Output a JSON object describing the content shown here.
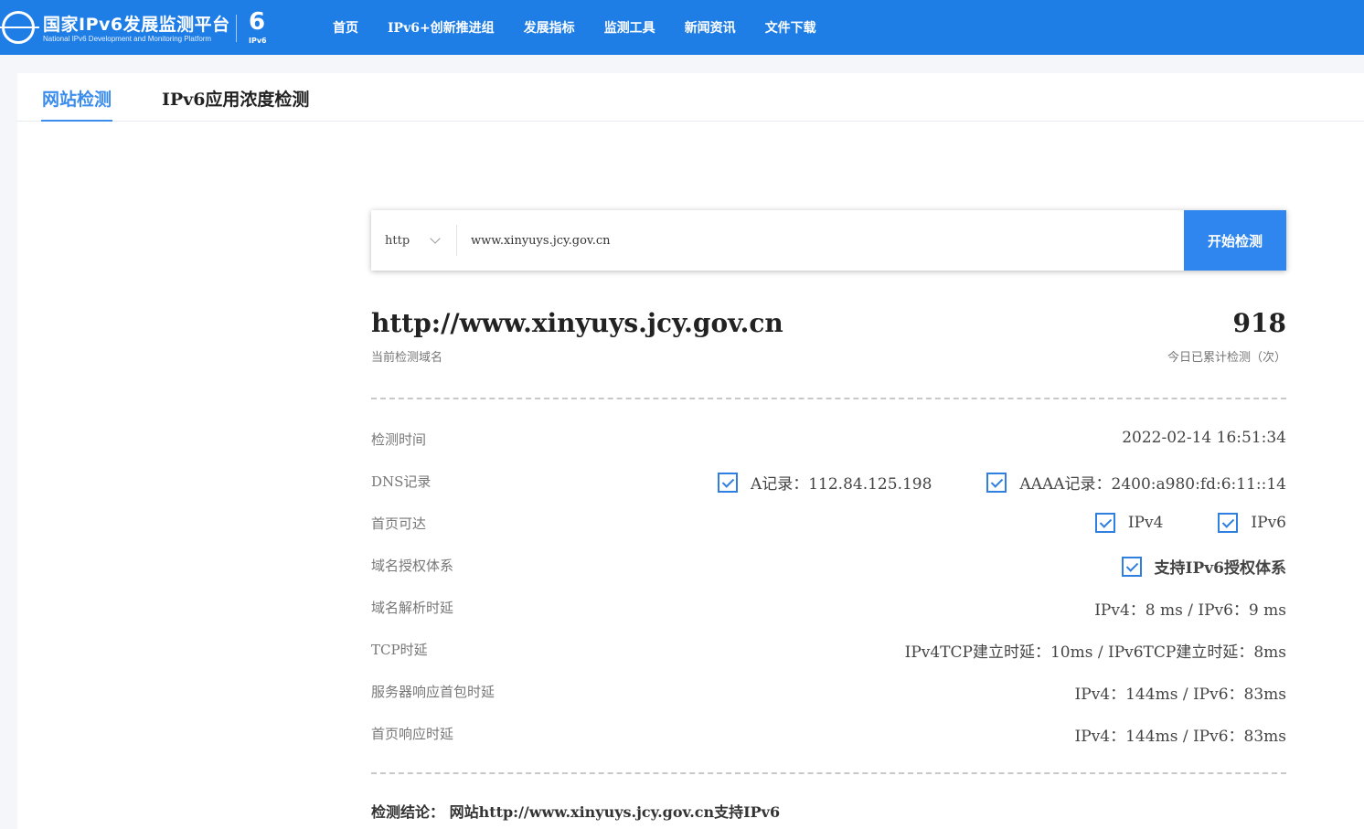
{
  "header": {
    "logo_title": "国家IPv6发展监测平台",
    "logo_subtitle": "National IPv6 Development and Monitoring Platform",
    "ipv6_mark": "IPv6",
    "nav": [
      "首页",
      "IPv6+创新推进组",
      "发展指标",
      "监测工具",
      "新闻资讯",
      "文件下载"
    ],
    "brand_color": "#1f7ee6"
  },
  "tabs": [
    {
      "label": "网站检测",
      "active": true
    },
    {
      "label": "IPv6应用浓度检测",
      "active": false
    }
  ],
  "search": {
    "protocol": "http",
    "url_value": "www.xinyuys.jcy.gov.cn",
    "button_label": "开始检测"
  },
  "result": {
    "domain": "http://www.xinyuys.jcy.gov.cn",
    "domain_label": "当前检测域名",
    "count": "918",
    "count_label": "今日已累计检测（次）",
    "rows": {
      "time": {
        "label": "检测时间",
        "value": "2022-02-14 16:51:34"
      },
      "dns": {
        "label": "DNS记录",
        "a_record": "A记录：112.84.125.198",
        "aaaa_record": "AAAA记录：2400:a980:fd:6:11::14"
      },
      "homepage": {
        "label": "首页可达",
        "ipv4": "IPv4",
        "ipv6": "IPv6"
      },
      "auth": {
        "label": "域名授权体系",
        "value": "支持IPv6授权体系"
      },
      "resolve": {
        "label": "域名解析时延",
        "value": "IPv4：8 ms / IPv6：9 ms"
      },
      "tcp": {
        "label": "TCP时延",
        "value": "IPv4TCP建立时延：10ms / IPv6TCP建立时延：8ms"
      },
      "first_packet": {
        "label": "服务器响应首包时延",
        "value": "IPv4：144ms / IPv6：83ms"
      },
      "homepage_resp": {
        "label": "首页响应时延",
        "value": "IPv4：144ms / IPv6：83ms"
      }
    },
    "conclusion": "检测结论：  网站http://www.xinyuys.jcy.gov.cn支持IPv6"
  }
}
